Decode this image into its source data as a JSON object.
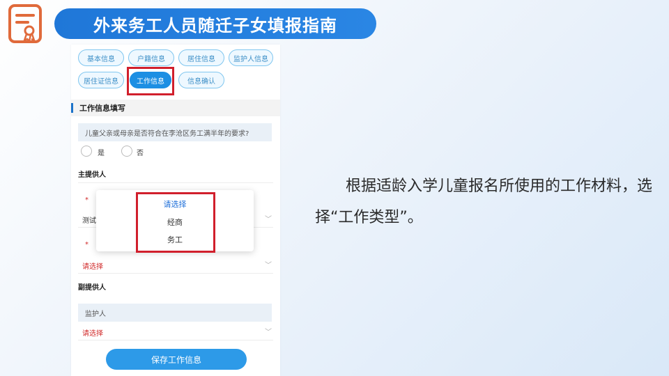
{
  "title": "外来务工人员随迁子女填报指南",
  "tabs": [
    {
      "label": "基本信息"
    },
    {
      "label": "户籍信息"
    },
    {
      "label": "居住信息"
    },
    {
      "label": "监护人信息"
    },
    {
      "label": "居住证信息"
    },
    {
      "label": "工作信息"
    },
    {
      "label": "信息确认"
    }
  ],
  "form": {
    "section_title": "工作信息填写",
    "question": "儿童父亲或母亲是否符合在李沧区务工满半年的要求?",
    "options": [
      "是",
      "否"
    ],
    "primary_provider_label": "主提供人",
    "primary_field1_value": "测试",
    "primary_field2_value": "请选择",
    "secondary_provider_label": "副提供人",
    "guardian_placeholder": "监护人",
    "secondary_field_value": "请选择",
    "save_button": "保存工作信息"
  },
  "popup": {
    "items": [
      "请选择",
      "经商",
      "务工"
    ]
  },
  "instruction": "根据适龄入学儿童报名所使用的工作材料，选择“工作类型”。",
  "colors": {
    "accent": "#1f77d8",
    "highlight": "#d11f2c",
    "logo": "#e06a3b"
  }
}
